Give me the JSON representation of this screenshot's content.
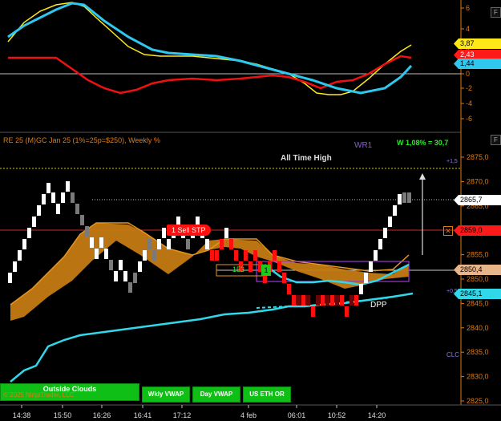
{
  "indicator_panel": {
    "y_ticks": [
      "6",
      "4",
      "2",
      "0",
      "-2",
      "-4",
      "-6"
    ],
    "badges": [
      {
        "label": "3,87",
        "bg": "#ffe81a",
        "fg": "#000000"
      },
      {
        "label": "2,43",
        "bg": "#ff1a1a",
        "fg": "#ffffff"
      },
      {
        "label": "1,44",
        "bg": "#2ec8ef",
        "fg": "#000000"
      }
    ],
    "corner_label": "F"
  },
  "price_panel": {
    "header": "RE 25 (M)GC Jan 25 (1%=25p=$250), Weekly %",
    "wr_label": "WR1",
    "weekly_stat": "W 1,08% = 30,7",
    "all_time_high": "All Time High",
    "sell_stop_qty": "1",
    "sell_stop_label": "Sell STP",
    "position_qty": "153",
    "position_count": "1",
    "dpp_label": "DPP",
    "clc_label": "CLC",
    "corner_label": "F",
    "side_marks": [
      "+1,5",
      "+0,5"
    ],
    "y_ticks": [
      "2875,0",
      "2870,0",
      "2865,0",
      "2860,0",
      "2855,0",
      "2850,0",
      "2845,0",
      "2840,0",
      "2835,0",
      "2830,0",
      "2825,0"
    ],
    "price_badges": [
      {
        "label": "2865,7",
        "bg": "#ffffff",
        "fg": "#000000"
      },
      {
        "label": "2859,0",
        "bg": "#ff1a1a",
        "fg": "#000000"
      },
      {
        "label": "2850,4",
        "bg": "#e8b48a",
        "fg": "#000000"
      },
      {
        "label": "2845,1",
        "bg": "#30d8ea",
        "fg": "#000000"
      }
    ],
    "buttons": [
      {
        "label": "Outside Clouds"
      },
      {
        "label": "Wkly VWAP"
      },
      {
        "label": "Day VWAP"
      },
      {
        "label": "US ETH OR"
      }
    ],
    "copyright": "© 2025 NinjaTrader, LLC"
  },
  "x_axis": {
    "ticks": [
      "14:38",
      "15:50",
      "16:26",
      "16:41",
      "17:12",
      "4 feb",
      "06:01",
      "10:52",
      "14:20"
    ]
  },
  "colors": {
    "cloud": "#c47a12",
    "axis": "#e07a10",
    "up_brick": "#ffffff",
    "down_brick": "#ff1010",
    "vwap": "#30d8ea"
  }
}
